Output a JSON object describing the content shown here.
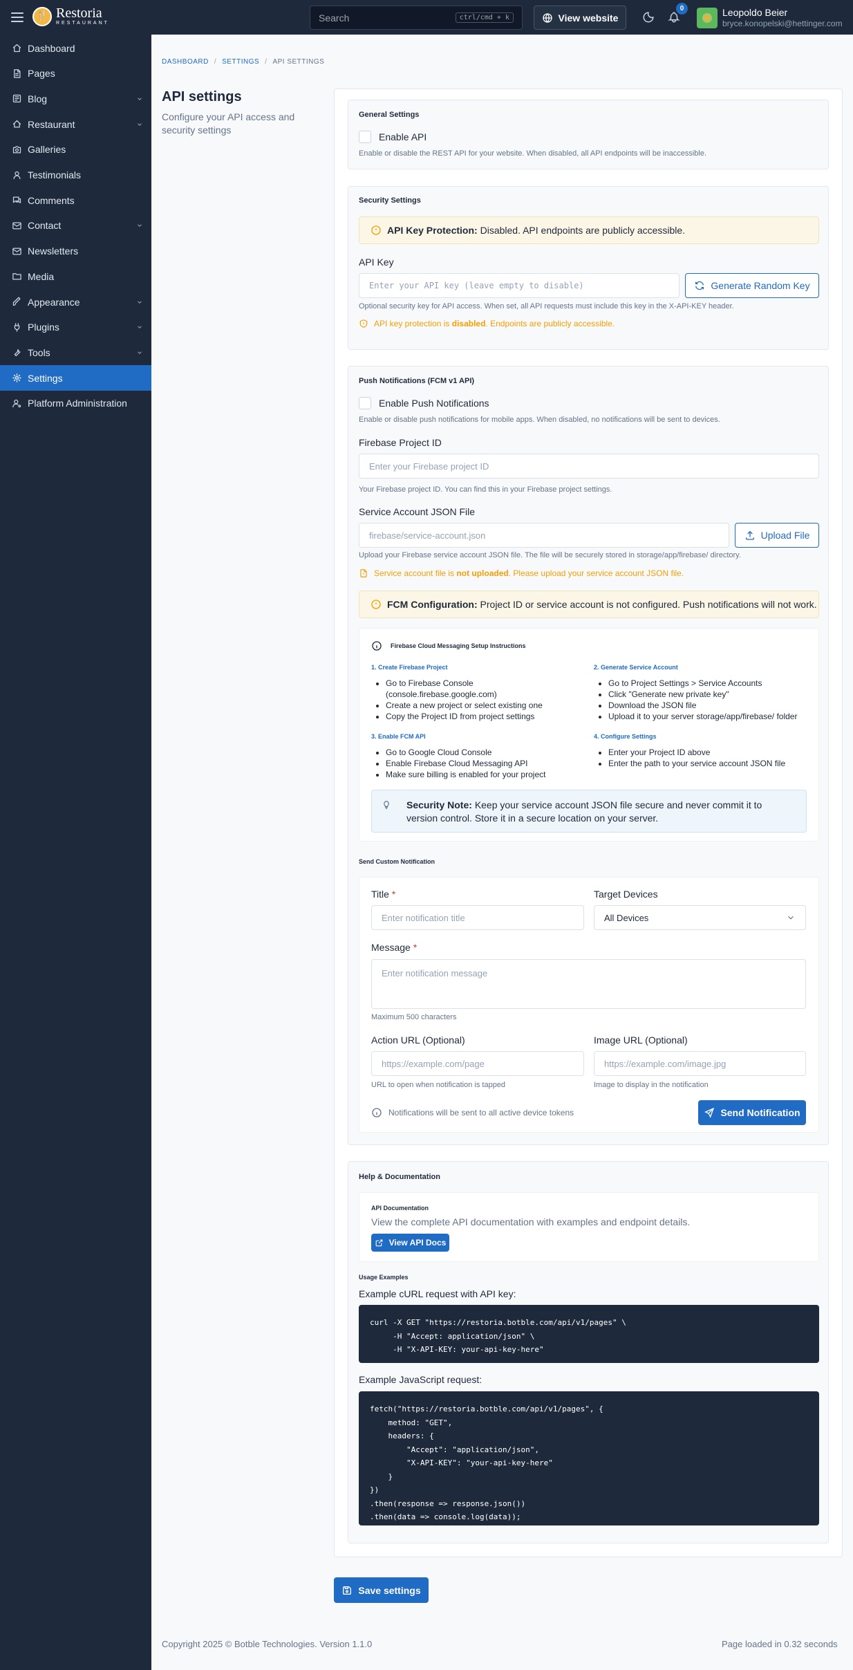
{
  "topbar": {
    "logo_name": "Restoria",
    "logo_sub": "RESTAURANT",
    "search_placeholder": "Search",
    "search_shortcut": "ctrl/cmd + k",
    "view_website": "View website",
    "notification_count": "0",
    "user_name": "Leopoldo Beier",
    "user_email": "bryce.konopelski@hettinger.com"
  },
  "sidebar": {
    "items": [
      {
        "label": "Dashboard",
        "icon": "home-icon",
        "has_children": false
      },
      {
        "label": "Pages",
        "icon": "page-icon",
        "has_children": false
      },
      {
        "label": "Blog",
        "icon": "article-icon",
        "has_children": true
      },
      {
        "label": "Restaurant",
        "icon": "restaurant-icon",
        "has_children": true
      },
      {
        "label": "Galleries",
        "icon": "camera-icon",
        "has_children": false
      },
      {
        "label": "Testimonials",
        "icon": "user-icon",
        "has_children": false
      },
      {
        "label": "Comments",
        "icon": "comments-icon",
        "has_children": false
      },
      {
        "label": "Contact",
        "icon": "mail-icon",
        "has_children": true
      },
      {
        "label": "Newsletters",
        "icon": "mail-icon",
        "has_children": false
      },
      {
        "label": "Media",
        "icon": "folder-icon",
        "has_children": false
      },
      {
        "label": "Appearance",
        "icon": "brush-icon",
        "has_children": true
      },
      {
        "label": "Plugins",
        "icon": "plug-icon",
        "has_children": true
      },
      {
        "label": "Tools",
        "icon": "tool-icon",
        "has_children": true
      },
      {
        "label": "Settings",
        "icon": "gear-icon",
        "has_children": false,
        "active": true
      },
      {
        "label": "Platform Administration",
        "icon": "user-cog-icon",
        "has_children": false
      }
    ]
  },
  "breadcrumb": {
    "dashboard": "DASHBOARD",
    "settings": "SETTINGS",
    "current": "API SETTINGS"
  },
  "page": {
    "title": "API settings",
    "description": "Configure your API access and security settings"
  },
  "general": {
    "title": "General Settings",
    "enable_api_label": "Enable API",
    "enable_api_help": "Enable or disable the REST API for your website. When disabled, all API endpoints will be inaccessible."
  },
  "security": {
    "title": "Security Settings",
    "alert_bold": "API Key Protection:",
    "alert_text": "Disabled. API endpoints are publicly accessible.",
    "api_key_label": "API Key",
    "api_key_placeholder": "Enter your API key (leave empty to disable)",
    "generate_button": "Generate Random Key",
    "api_key_help": "Optional security key for API access. When set, all API requests must include this key in the X-API-KEY header.",
    "warn_prefix": "API key protection is",
    "warn_bold": "disabled",
    "warn_suffix": ". Endpoints are publicly accessible."
  },
  "push": {
    "title": "Push Notifications (FCM v1 API)",
    "enable_label": "Enable Push Notifications",
    "enable_help": "Enable or disable push notifications for mobile apps. When disabled, no notifications will be sent to devices.",
    "project_id_label": "Firebase Project ID",
    "project_id_placeholder": "Enter your Firebase project ID",
    "project_id_help": "Your Firebase project ID. You can find this in your Firebase project settings.",
    "json_label": "Service Account JSON File",
    "json_placeholder": "firebase/service-account.json",
    "upload_button": "Upload File",
    "json_help": "Upload your Firebase service account JSON file. The file will be securely stored in storage/app/firebase/ directory.",
    "json_warn_prefix": "Service account file is",
    "json_warn_bold": "not uploaded",
    "json_warn_suffix": ". Please upload your service account JSON file.",
    "fcm_alert_bold": "FCM Configuration:",
    "fcm_alert_text": "Project ID or service account is not configured. Push notifications will not work.",
    "instructions_title": "Firebase Cloud Messaging Setup Instructions",
    "steps": [
      {
        "title": "1. Create Firebase Project",
        "items": [
          "Go to Firebase Console (console.firebase.google.com)",
          "Create a new project or select existing one",
          "Copy the Project ID from project settings"
        ]
      },
      {
        "title": "2. Generate Service Account",
        "items": [
          "Go to Project Settings > Service Accounts",
          "Click \"Generate new private key\"",
          "Download the JSON file",
          "Upload it to your server storage/app/firebase/ folder"
        ]
      },
      {
        "title": "3. Enable FCM API",
        "items": [
          "Go to Google Cloud Console",
          "Enable Firebase Cloud Messaging API",
          "Make sure billing is enabled for your project"
        ]
      },
      {
        "title": "4. Configure Settings",
        "items": [
          "Enter your Project ID above",
          "Enter the path to your service account JSON file"
        ]
      }
    ],
    "security_note_bold": "Security Note:",
    "security_note_text": "Keep your service account JSON file secure and never commit it to version control. Store it in a secure location on your server."
  },
  "custom_notification": {
    "title": "Send Custom Notification",
    "title_label": "Title",
    "title_placeholder": "Enter notification title",
    "target_label": "Target Devices",
    "target_value": "All Devices",
    "message_label": "Message",
    "message_placeholder": "Enter notification message",
    "message_help": "Maximum 500 characters",
    "action_url_label": "Action URL (Optional)",
    "action_url_placeholder": "https://example.com/page",
    "action_url_help": "URL to open when notification is tapped",
    "image_url_label": "Image URL (Optional)",
    "image_url_placeholder": "https://example.com/image.jpg",
    "image_url_help": "Image to display in the notification",
    "info_text": "Notifications will be sent to all active device tokens",
    "send_button": "Send Notification"
  },
  "help": {
    "title": "Help & Documentation",
    "doc_title": "API Documentation",
    "doc_text": "View the complete API documentation with examples and endpoint details.",
    "doc_button": "View API Docs",
    "usage_title": "Usage Examples",
    "curl_label": "Example cURL request with API key:",
    "curl_code": "curl -X GET \"https://restoria.botble.com/api/v1/pages\" \\\n     -H \"Accept: application/json\" \\\n     -H \"X-API-KEY: your-api-key-here\"",
    "js_label": "Example JavaScript request:",
    "js_code": "fetch(\"https://restoria.botble.com/api/v1/pages\", {\n    method: \"GET\",\n    headers: {\n        \"Accept\": \"application/json\",\n        \"X-API-KEY\": \"your-api-key-here\"\n    }\n})\n.then(response => response.json())\n.then(data => console.log(data));"
  },
  "save_button": "Save settings",
  "footer": {
    "copyright": "Copyright 2025 © Botble Technologies. Version",
    "version": "1.1.0",
    "loaded": "Page loaded in 0.32 seconds"
  },
  "colors": {
    "primary": "#206bc4",
    "sidebar": "#1e2a3b",
    "warning": "#f59f00"
  }
}
